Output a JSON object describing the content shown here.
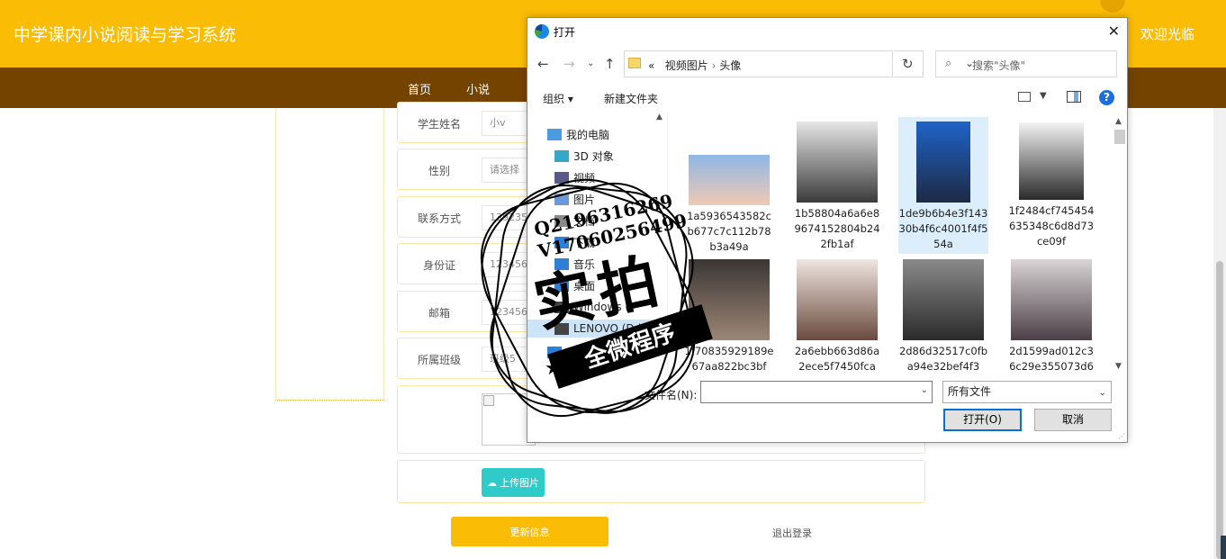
{
  "header": {
    "site_title": "中学课内小说阅读与学习系统",
    "welcome": "欢迎光临"
  },
  "nav": {
    "items": [
      "首页",
      "小说"
    ]
  },
  "form": {
    "rows": [
      {
        "label": "学生姓名",
        "value": "小v"
      },
      {
        "label": "性别",
        "value": "请选择"
      },
      {
        "label": "联系方式",
        "value": "139235"
      },
      {
        "label": "身份证",
        "value": "1234567"
      },
      {
        "label": "邮箱",
        "value": "1234561"
      },
      {
        "label": "所属班级",
        "value": "班级5"
      }
    ],
    "upload_label": "上传图片",
    "update_label": "更新信息",
    "logout_label": "退出登录"
  },
  "dialog": {
    "title": "打开",
    "address": [
      "视频图片",
      "头像"
    ],
    "address_prefix": "«",
    "search_placeholder": "搜索\"头像\"",
    "organize_label": "组织 ▾",
    "new_folder_label": "新建文件夹",
    "tree": [
      {
        "label": "我的电脑",
        "color": "#4a9be0"
      },
      {
        "label": "3D 对象",
        "color": "#36a7c9"
      },
      {
        "label": "视频",
        "color": "#5a5a8a"
      },
      {
        "label": "图片",
        "color": "#6a9bd8"
      },
      {
        "label": "文档",
        "color": "#8a8a8a"
      },
      {
        "label": "下载",
        "color": "#2e7fd6"
      },
      {
        "label": "音乐",
        "color": "#2e7fd6"
      },
      {
        "label": "桌面",
        "color": "#2e7fd6"
      },
      {
        "label": "Windows (",
        "color": "#444"
      },
      {
        "label": "LENOVO (D:)",
        "color": "#444"
      },
      {
        "label": "网络",
        "color": "#2e7fd6"
      }
    ],
    "files": [
      {
        "name": "1a5936543582cb677c7c112b78b3a49a",
        "colors": [
          "#8fb7e6",
          "#f0c9b4"
        ]
      },
      {
        "name": "1b58804a6a6e89674152804b242fb1af",
        "colors": [
          "#e6e6e6",
          "#3a3a3a"
        ]
      },
      {
        "name": "1de9b6b4e3f14330b4f6c4001f4f554a",
        "colors": [
          "#1f63c8",
          "#1d2a45"
        ]
      },
      {
        "name": "1f2484cf745454635348c6d8d73ce09f",
        "colors": [
          "#f3f3f3",
          "#2a2a2a"
        ]
      },
      {
        "name": "1f70835929189e67aa822bc3bf",
        "colors": [
          "#3b3634",
          "#9c8676"
        ]
      },
      {
        "name": "2a6ebb663d86a2ece5f7450fca",
        "colors": [
          "#efe5e1",
          "#6b4a3e"
        ]
      },
      {
        "name": "2d86d32517c0fba94e32bef4f3",
        "colors": [
          "#8a8a8a",
          "#2a2a2a"
        ]
      },
      {
        "name": "2d1599ad012c36c29e355073d6",
        "colors": [
          "#d9d4d6",
          "#4b3f45"
        ]
      }
    ],
    "filename_label": "文件名(N):",
    "filename_value": "",
    "filter_value": "所有文件",
    "open_label": "打开(O)",
    "cancel_label": "取消"
  },
  "watermark": {
    "line1": "Q2196316269",
    "line2": "V17060256499",
    "big": "实拍",
    "band": "全微程序"
  },
  "colors": {
    "header": "#fbbc05",
    "nav": "#754300",
    "upload": "#2ecbc9",
    "accent": "#0b6ed4"
  }
}
